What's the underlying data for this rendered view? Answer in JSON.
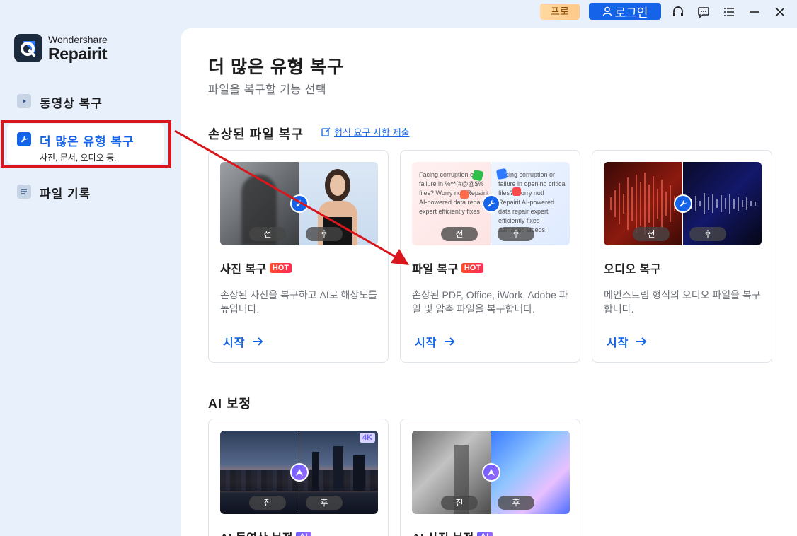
{
  "titlebar": {
    "pro_label": "프로",
    "login_label": "로그인",
    "icons": [
      "headset-icon",
      "chat-icon",
      "menu-icon",
      "minimize-icon",
      "close-icon"
    ]
  },
  "app": {
    "brand_top": "Wondershare",
    "brand_name": "Repairit"
  },
  "sidebar": {
    "items": [
      {
        "label": "동영상 복구",
        "icon": "video-icon"
      },
      {
        "label": "더 많은 유형 복구",
        "sub": "사진, 문서, 오디오 등.",
        "icon": "wrench-icon",
        "active": true
      },
      {
        "label": "파일 기록",
        "icon": "file-list-icon"
      }
    ]
  },
  "main": {
    "title": "더 많은 유형 복구",
    "subtitle": "파일을 복구할 기능 선택",
    "damaged_section": {
      "title": "손상된 파일 복구",
      "link": "형식 요구 사항 제출",
      "cards": [
        {
          "title": "사진 복구",
          "tag": "HOT",
          "desc": "손상된 사진을 복구하고 AI로 해상도를 높입니다.",
          "start": "시작",
          "before": "전",
          "after": "후"
        },
        {
          "title": "파일 복구",
          "tag": "HOT",
          "desc": "손상된 PDF, Office, iWork, Adobe 파일 및 압축 파일을 복구합니다.",
          "start": "시작",
          "before": "전",
          "after": "후",
          "thumb_left": "Facing corruption or failure in %^*(#@@$% files? Worry not! Repairit AI-powered data repair expert efficiently fixes",
          "thumb_right": "Facing corruption or failure in opening critical files? Worry not! Repairit AI-powered data repair expert efficiently fixes damaged videos,"
        },
        {
          "title": "오디오 복구",
          "tag": "",
          "desc": "메인스트림 형식의 오디오 파일을 복구합니다.",
          "start": "시작",
          "before": "전",
          "after": "후"
        }
      ]
    },
    "ai_section": {
      "title": "AI 보정",
      "cards": [
        {
          "title": "AI 동영상 보정",
          "tag": "AI",
          "before": "전",
          "after": "후",
          "badge": "4K"
        },
        {
          "title": "AI 사진 보정",
          "tag": "AI",
          "before": "전",
          "after": "후"
        }
      ]
    }
  },
  "colors": {
    "accent": "#1463e8",
    "annotation": "#d9161c",
    "hot": "#ff3b3b"
  }
}
